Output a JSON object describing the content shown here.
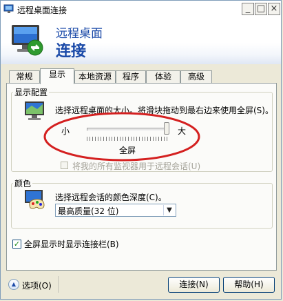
{
  "window": {
    "title": "远程桌面连接",
    "controls": {
      "minimize": "_",
      "maximize": "□",
      "close": "×"
    }
  },
  "banner": {
    "line1": "远程桌面",
    "line2": "连接"
  },
  "tabs": [
    {
      "label": "常规",
      "active": false
    },
    {
      "label": "显示",
      "active": true
    },
    {
      "label": "本地资源",
      "active": false
    },
    {
      "label": "程序",
      "active": false
    },
    {
      "label": "体验",
      "active": false
    },
    {
      "label": "高级",
      "active": false
    }
  ],
  "display": {
    "group_label": "显示配置",
    "description": "选择远程桌面的大小。将滑块拖动到最右边来使用全屏(S)。",
    "slider": {
      "min_label": "小",
      "max_label": "大",
      "value_label": "全屏",
      "position_fraction": 1.0
    },
    "multimonitor_label": "将我的所有监视器用于远程会话(U)",
    "multimonitor_checked": false,
    "multimonitor_enabled": false
  },
  "colors": {
    "group_label": "颜色",
    "description": "选择远程会话的颜色深度(C)。",
    "selected": "最高质量(32 位)"
  },
  "fullscreen_bar": {
    "label": "全屏显示时显示连接栏(B)",
    "checked": true,
    "check_glyph": "✓"
  },
  "footer": {
    "options_label": "选项(O)",
    "options_glyph": "▲",
    "connect_label": "连接(N)",
    "help_label": "帮助(H)"
  },
  "annotation": {
    "color": "#d42020"
  },
  "theme": {
    "banner_text": "#1b4aa8",
    "window_bg": "#ece9d8"
  }
}
